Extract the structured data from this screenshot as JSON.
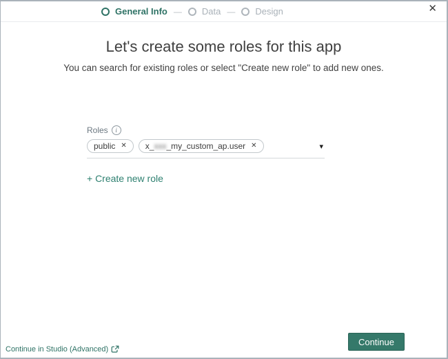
{
  "colors": {
    "accent_green": "#2e7265",
    "button_green": "#35796a",
    "inactive_gray": "#a9b1b8",
    "text_dark": "#404040"
  },
  "window": {
    "close_icon": "✕"
  },
  "stepper": {
    "separator": "—",
    "steps": [
      {
        "label": "General Info",
        "state": "active"
      },
      {
        "label": "Data",
        "state": "inactive"
      },
      {
        "label": "Design",
        "state": "inactive"
      }
    ]
  },
  "main": {
    "title": "Let's create some roles for this app",
    "subtitle": "You can search for existing roles or select \"Create new role\" to add new ones."
  },
  "roles_field": {
    "label": "Roles",
    "info_icon": "i",
    "chip_remove_icon": "✕",
    "dropdown_icon": "▾",
    "chips": [
      {
        "label": "public"
      },
      {
        "label_prefix": "x_",
        "label_redacted": "xxx",
        "label_suffix": "_my_custom_ap.user"
      }
    ],
    "create_new_role_label": "+ Create new role"
  },
  "footer": {
    "studio_link_label": "Continue in Studio (Advanced)",
    "continue_button_label": "Continue"
  }
}
